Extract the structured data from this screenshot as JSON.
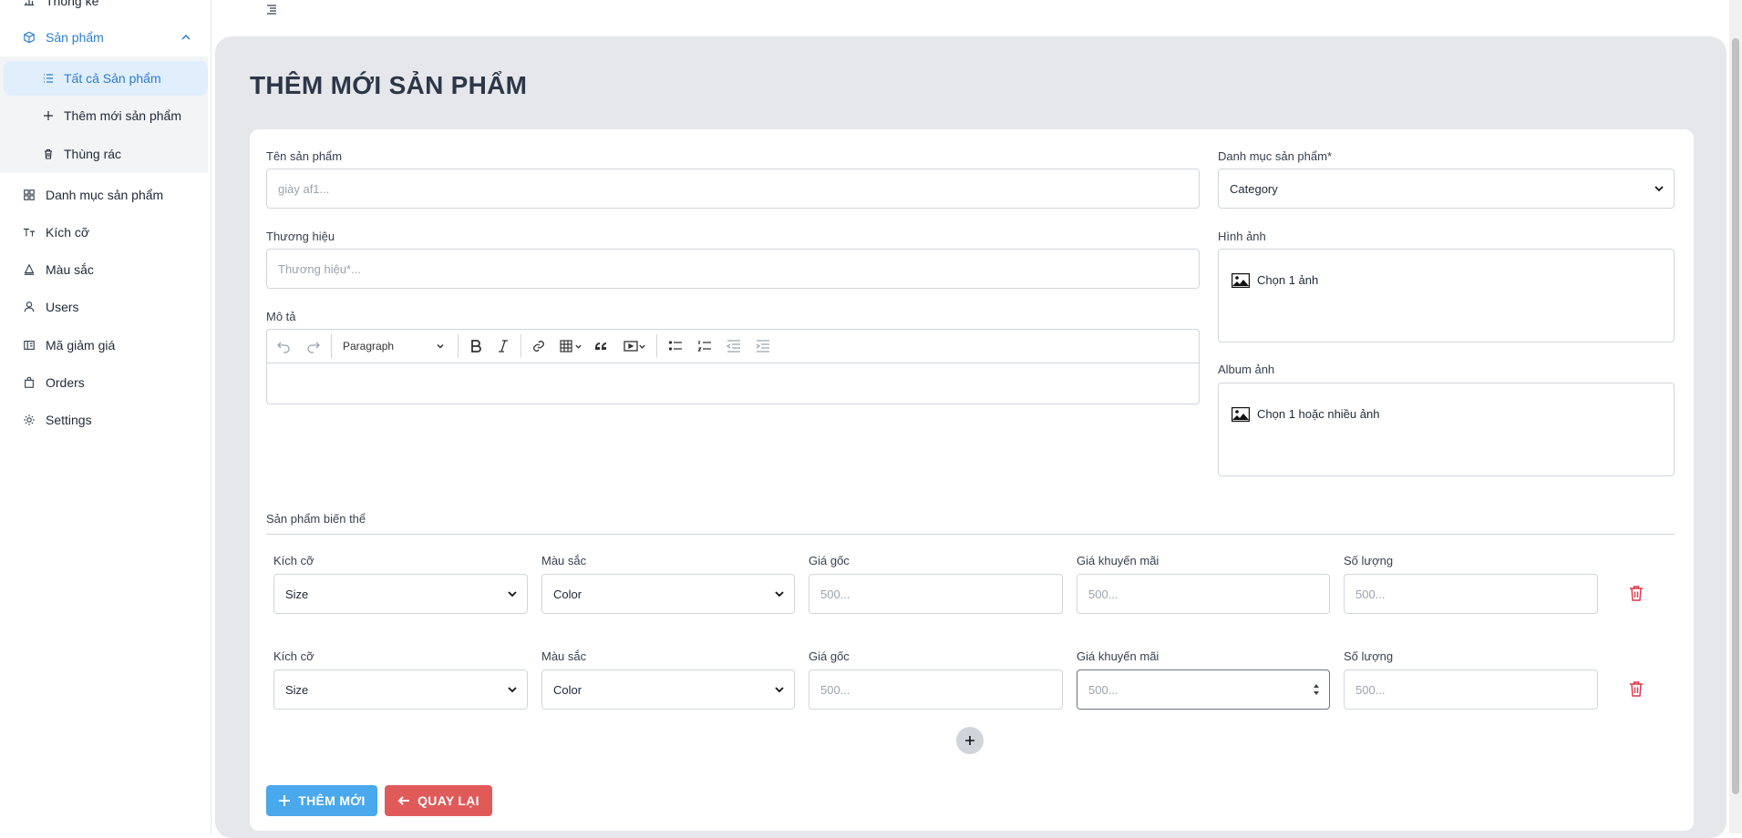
{
  "sidebar": {
    "items": [
      {
        "label": "Thống kê"
      },
      {
        "label": "Sản phẩm"
      },
      {
        "label": "Danh mục sản phẩm"
      },
      {
        "label": "Kích cỡ"
      },
      {
        "label": "Màu sắc"
      },
      {
        "label": "Users"
      },
      {
        "label": "Mã giảm giá"
      },
      {
        "label": "Orders"
      },
      {
        "label": "Settings"
      }
    ],
    "submenu": [
      {
        "label": "Tất cả Sản phẩm"
      },
      {
        "label": "Thêm mới sản phẩm"
      },
      {
        "label": "Thùng rác"
      }
    ]
  },
  "page": {
    "title": "THÊM MỚI SẢN PHẨM"
  },
  "form": {
    "name_label": "Tên sản phẩm",
    "name_placeholder": "giày af1...",
    "brand_label": "Thương hiệu",
    "brand_placeholder": "Thương hiệu*...",
    "desc_label": "Mô tả",
    "paragraph_label": "Paragraph",
    "category_label": "Danh mục sản phẩm*",
    "category_value": "Category",
    "image_label": "Hình ảnh",
    "image_button": "Chọn 1 ảnh",
    "album_label": "Album ảnh",
    "album_button": "Chọn 1 hoặc nhiều ảnh"
  },
  "variants": {
    "title": "Sản phẩm biến thể",
    "rows": [
      {
        "size_label": "Kích cỡ",
        "size_value": "Size",
        "color_label": "Màu sắc",
        "color_value": "Color",
        "price_label": "Giá gốc",
        "price_placeholder": "500...",
        "sale_label": "Giá khuyến mãi",
        "sale_placeholder": "500...",
        "qty_label": "Số lượng",
        "qty_placeholder": "500..."
      },
      {
        "size_label": "Kích cỡ",
        "size_value": "Size",
        "color_label": "Màu sắc",
        "color_value": "Color",
        "price_label": "Giá gốc",
        "price_placeholder": "500...",
        "sale_label": "Giá khuyến mãi",
        "sale_placeholder": "500...",
        "qty_label": "Số lượng",
        "qty_placeholder": "500..."
      }
    ]
  },
  "actions": {
    "add_label": "THÊM MỚI",
    "back_label": "QUAY LẠI"
  },
  "colors": {
    "accent": "#2d7dd2",
    "add_button": "#4aa8ec",
    "back_button": "#e05a5a",
    "danger": "#dc3545"
  }
}
